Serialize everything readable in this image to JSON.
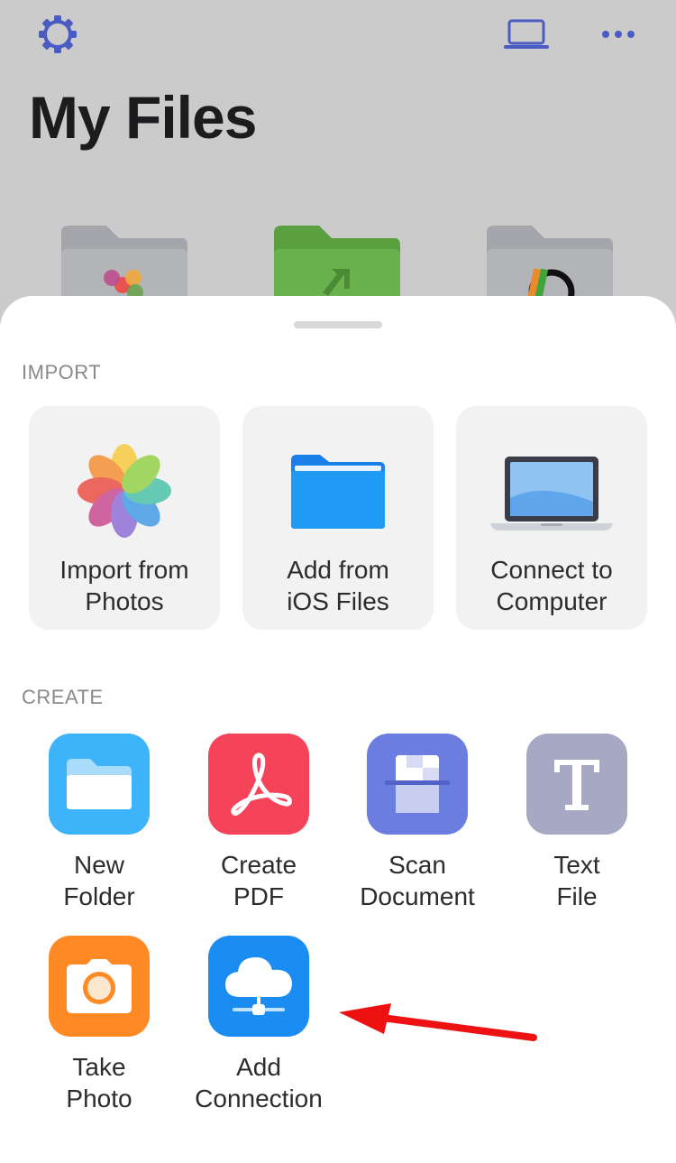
{
  "header": {
    "title": "My Files",
    "settings_icon": "gear-icon",
    "computer_icon": "laptop-icon",
    "more_icon": "ellipsis-icon"
  },
  "background_folders": [
    {
      "name": "photos-folder-icon"
    },
    {
      "name": "import-folder-icon"
    },
    {
      "name": "app-folder-icon"
    }
  ],
  "sheet": {
    "import_section": {
      "label": "IMPORT",
      "items": [
        {
          "line1": "Import from",
          "line2": "Photos",
          "icon": "photos-icon"
        },
        {
          "line1": "Add from",
          "line2": "iOS Files",
          "icon": "blue-folder-icon"
        },
        {
          "line1": "Connect to",
          "line2": "Computer",
          "icon": "laptop-icon"
        }
      ]
    },
    "create_section": {
      "label": "CREATE",
      "items": [
        {
          "line1": "New",
          "line2": "Folder",
          "icon": "open-folder-icon",
          "color": "#3db4f9"
        },
        {
          "line1": "Create",
          "line2": "PDF",
          "icon": "acrobat-icon",
          "color": "#f5435a"
        },
        {
          "line1": "Scan",
          "line2": "Document",
          "icon": "scanner-icon",
          "color": "#6c7de0"
        },
        {
          "line1": "Text",
          "line2": "File",
          "icon": "text-t-icon",
          "color": "#a6a8c4"
        },
        {
          "line1": "Take",
          "line2": "Photo",
          "icon": "camera-icon",
          "color": "#ff8a25"
        },
        {
          "line1": "Add",
          "line2": "Connection",
          "icon": "cloud-network-icon",
          "color": "#1a8cf2"
        }
      ]
    }
  },
  "annotation": {
    "arrow_color": "#ee1111"
  }
}
